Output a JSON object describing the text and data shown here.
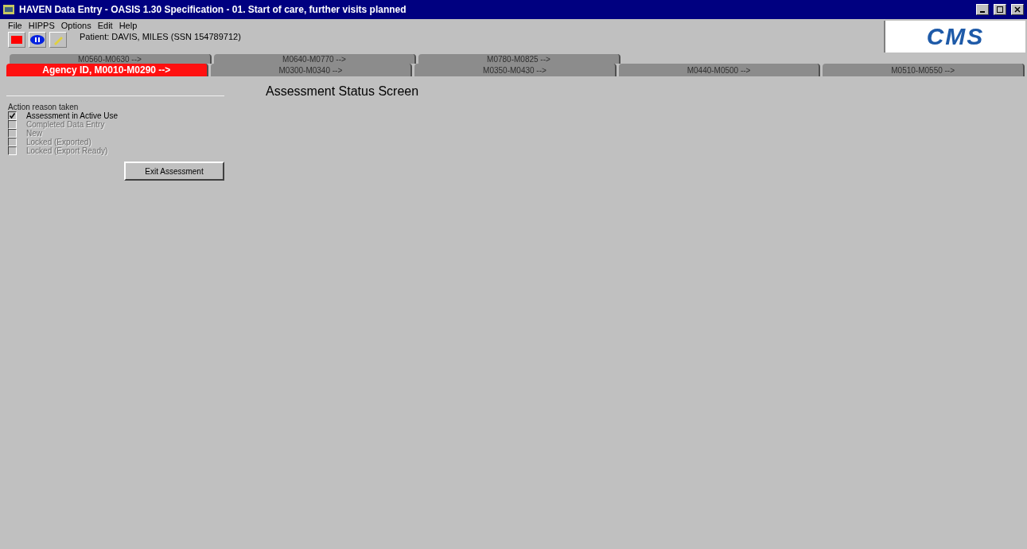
{
  "window": {
    "title": "HAVEN Data Entry - OASIS 1.30 Specification - 01. Start of care, further visits planned"
  },
  "menu": [
    "File",
    "HIPPS",
    "Options",
    "Edit",
    "Help"
  ],
  "patient": "Patient: DAVIS, MILES (SSN 154789712)",
  "logo": "CMS",
  "tab_rows": [
    [
      {
        "label": "M0560-M0630 -->",
        "selected": false
      },
      {
        "label": "M0640-M0770 -->",
        "selected": false
      },
      {
        "label": "M0780-M0825 -->",
        "selected": false
      }
    ],
    [
      {
        "label": "Agency ID, M0010-M0290 -->",
        "selected": true
      },
      {
        "label": "M0300-M0340 -->",
        "selected": false
      },
      {
        "label": "M0350-M0430 -->",
        "selected": false
      },
      {
        "label": "M0440-M0500 -->",
        "selected": false
      },
      {
        "label": "M0510-M0550 -->",
        "selected": false
      }
    ]
  ],
  "heading": "Assessment Status Screen",
  "action_group": {
    "label": "Action reason taken",
    "options": [
      {
        "label": "Assessment in Active Use",
        "checked": true,
        "disabled": false
      },
      {
        "label": "Completed Data Entry",
        "checked": false,
        "disabled": true
      },
      {
        "label": "New",
        "checked": false,
        "disabled": true
      },
      {
        "label": "Locked (Exported)",
        "checked": false,
        "disabled": true
      },
      {
        "label": "Locked (Export Ready)",
        "checked": false,
        "disabled": true
      }
    ]
  },
  "buttons": [
    "Exit Assessment"
  ]
}
